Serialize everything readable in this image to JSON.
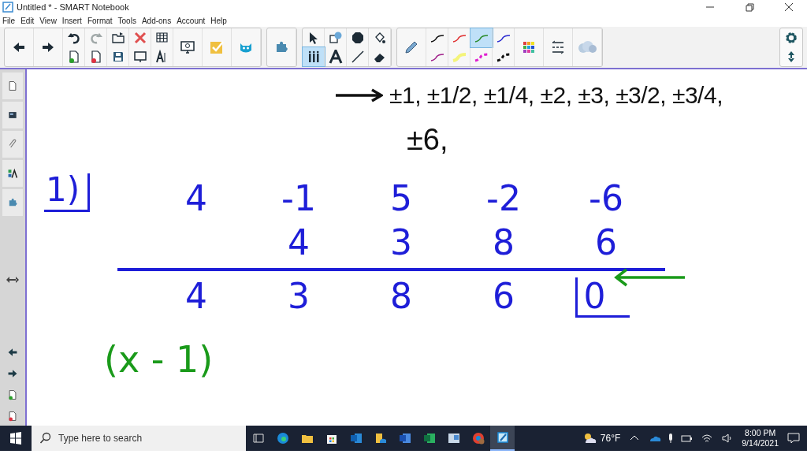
{
  "window": {
    "title": "Untitled * - SMART Notebook"
  },
  "menu": [
    "File",
    "Edit",
    "View",
    "Insert",
    "Format",
    "Tools",
    "Add-ons",
    "Account",
    "Help"
  ],
  "select_tools": [
    {
      "selected": false
    },
    {
      "selected": false
    },
    {
      "selected": false
    },
    {
      "selected": false
    },
    {
      "selected": true
    },
    {
      "selected": false
    },
    {
      "selected": false
    },
    {
      "selected": false
    }
  ],
  "pens": [
    {
      "kind": "pen",
      "color": "#111111",
      "selected": false
    },
    {
      "kind": "pen",
      "color": "#e03030",
      "selected": false
    },
    {
      "kind": "pen",
      "color": "#2a8a2a",
      "selected": true
    },
    {
      "kind": "pen",
      "color": "#2a2ad0",
      "selected": false
    },
    {
      "kind": "pen",
      "color": "#a0208a",
      "selected": false
    },
    {
      "kind": "highlighter",
      "color": "#f4f47a",
      "selected": false
    },
    {
      "kind": "dashed",
      "color": "#e020d0",
      "selected": false
    },
    {
      "kind": "dashed",
      "color": "#111111",
      "selected": false
    }
  ],
  "canvas": {
    "candidates": [
      "±1, ±1/2, ±1/4, ±2, ±3, ±3/2, ±3/4,",
      "±6,"
    ],
    "problem_label": "1)",
    "coefficients": [
      "4",
      "-1",
      "5",
      "-2",
      "-6"
    ],
    "products": [
      "4",
      "3",
      "8",
      "6"
    ],
    "results": [
      "4",
      "3",
      "8",
      "6",
      "0"
    ],
    "factor": "(x - 1)"
  },
  "taskbar": {
    "search_placeholder": "Type here to search",
    "apps": [
      {
        "active": false
      },
      {
        "active": false
      },
      {
        "active": false
      },
      {
        "active": false
      },
      {
        "active": false
      },
      {
        "active": false
      },
      {
        "active": false
      },
      {
        "active": false
      },
      {
        "active": false
      },
      {
        "active": false
      },
      {
        "active": true
      }
    ],
    "weather": "76°F",
    "time": "8:00 PM",
    "date": "9/14/2021"
  }
}
